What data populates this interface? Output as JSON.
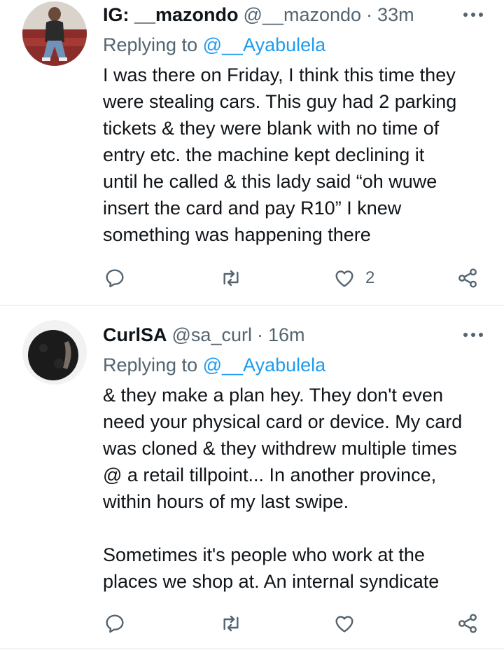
{
  "tweets": [
    {
      "display_name": "IG: __mazondo",
      "handle": "@__mazondo",
      "separator": "·",
      "time": "33m",
      "replying_prefix": "Replying to",
      "replying_handle": "@__Ayabulela",
      "lines": [
        "I was there on Friday, I think this time they",
        "were stealing cars. This guy had 2 parking",
        "tickets & they were blank with no time of",
        "entry etc. the machine kept declining it",
        "until he called & this lady said “oh wuwe",
        "insert the card and pay R10” I knew",
        "something was happening there"
      ],
      "like_count": "2",
      "avatar_icon": "profile-photo",
      "colors": {
        "avatar_bg": "#8a2d2a"
      }
    },
    {
      "display_name": "CurlSA",
      "handle": "@sa_curl",
      "separator": "·",
      "time": "16m",
      "replying_prefix": "Replying to",
      "replying_handle": "@__Ayabulela",
      "lines": [
        "& they make a plan hey. They don't even",
        "need your physical card or device. My card",
        "was cloned & they withdrew multiple times",
        "@ a retail tillpoint... In another province,",
        "within hours of my last swipe.",
        "",
        "Sometimes it's people who work at the",
        "places we shop at. An internal syndicate"
      ],
      "like_count": "",
      "avatar_icon": "profile-photo",
      "colors": {
        "avatar_bg": "#1b1b1b"
      }
    }
  ],
  "theme": {
    "text": "#0f1419",
    "secondary": "#536471",
    "link": "#1d9bf0",
    "divider": "#eff3f4"
  }
}
